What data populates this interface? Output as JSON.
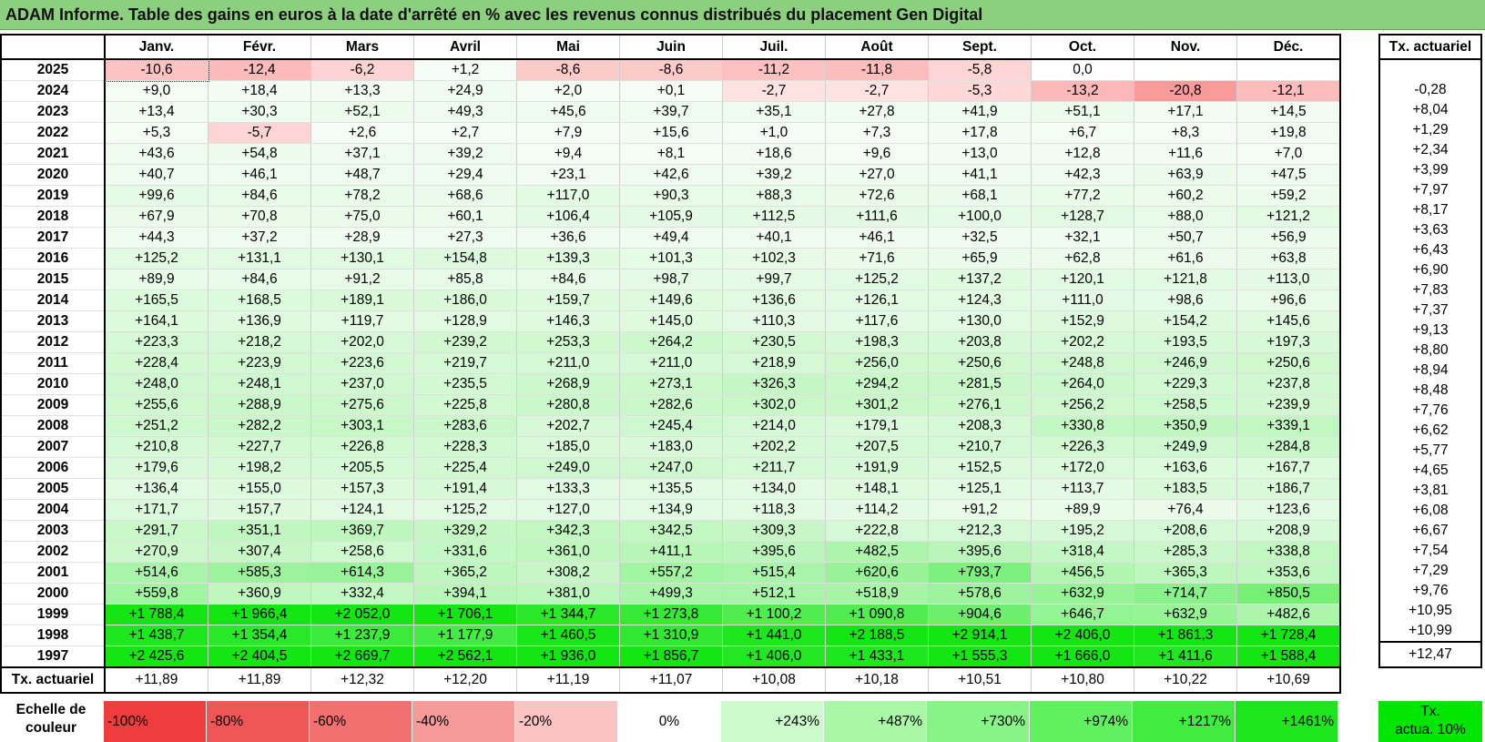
{
  "title": "ADAM Informe. Table des gains en euros à la date d'arrêté en % avec les revenus connus distribués du placement Gen Digital",
  "months": [
    "Janv.",
    "Févr.",
    "Mars",
    "Avril",
    "Mai",
    "Juin",
    "Juil.",
    "Août",
    "Sept.",
    "Oct.",
    "Nov.",
    "Déc."
  ],
  "actuarial_header": "Tx. actuariel",
  "rows": [
    {
      "year": "2025",
      "values": [
        "-10,6",
        "-12,4",
        "-6,2",
        "+1,2",
        "-8,6",
        "-8,6",
        "-11,2",
        "-11,8",
        "-5,8",
        "0,0",
        "",
        ""
      ],
      "rate": ""
    },
    {
      "year": "2024",
      "values": [
        "+9,0",
        "+18,4",
        "+13,3",
        "+24,9",
        "+2,0",
        "+0,1",
        "-2,7",
        "-2,7",
        "-5,3",
        "-13,2",
        "-20,8",
        "-12,1"
      ],
      "rate": "-0,28"
    },
    {
      "year": "2023",
      "values": [
        "+13,4",
        "+30,3",
        "+52,1",
        "+49,3",
        "+45,6",
        "+39,7",
        "+35,1",
        "+27,8",
        "+41,9",
        "+51,1",
        "+17,1",
        "+14,5"
      ],
      "rate": "+8,04"
    },
    {
      "year": "2022",
      "values": [
        "+5,3",
        "-5,7",
        "+2,6",
        "+2,7",
        "+7,9",
        "+15,6",
        "+1,0",
        "+7,3",
        "+17,8",
        "+6,7",
        "+8,3",
        "+19,8"
      ],
      "rate": "+1,29"
    },
    {
      "year": "2021",
      "values": [
        "+43,6",
        "+54,8",
        "+37,1",
        "+39,2",
        "+9,4",
        "+8,1",
        "+18,6",
        "+9,6",
        "+13,0",
        "+12,8",
        "+11,6",
        "+7,0"
      ],
      "rate": "+2,34"
    },
    {
      "year": "2020",
      "values": [
        "+40,7",
        "+46,1",
        "+48,7",
        "+29,4",
        "+23,1",
        "+42,6",
        "+39,2",
        "+27,0",
        "+41,1",
        "+42,3",
        "+63,9",
        "+47,5"
      ],
      "rate": "+3,99"
    },
    {
      "year": "2019",
      "values": [
        "+99,6",
        "+84,6",
        "+78,2",
        "+68,6",
        "+117,0",
        "+90,3",
        "+88,3",
        "+72,6",
        "+68,1",
        "+77,2",
        "+60,2",
        "+59,2"
      ],
      "rate": "+7,97"
    },
    {
      "year": "2018",
      "values": [
        "+67,9",
        "+70,8",
        "+75,0",
        "+60,1",
        "+106,4",
        "+105,9",
        "+112,5",
        "+111,6",
        "+100,0",
        "+128,7",
        "+88,0",
        "+121,2"
      ],
      "rate": "+8,17"
    },
    {
      "year": "2017",
      "values": [
        "+44,3",
        "+37,2",
        "+28,9",
        "+27,3",
        "+36,6",
        "+49,4",
        "+40,1",
        "+46,1",
        "+32,5",
        "+32,1",
        "+50,7",
        "+56,9"
      ],
      "rate": "+3,63"
    },
    {
      "year": "2016",
      "values": [
        "+125,2",
        "+131,1",
        "+130,1",
        "+154,8",
        "+139,3",
        "+101,3",
        "+102,3",
        "+71,6",
        "+65,9",
        "+62,8",
        "+61,6",
        "+63,8"
      ],
      "rate": "+6,43"
    },
    {
      "year": "2015",
      "values": [
        "+89,9",
        "+84,6",
        "+91,2",
        "+85,8",
        "+84,6",
        "+98,7",
        "+99,7",
        "+125,2",
        "+137,2",
        "+120,1",
        "+121,8",
        "+113,0"
      ],
      "rate": "+6,90"
    },
    {
      "year": "2014",
      "values": [
        "+165,5",
        "+168,5",
        "+189,1",
        "+186,0",
        "+159,7",
        "+149,6",
        "+136,6",
        "+126,1",
        "+124,3",
        "+111,0",
        "+98,6",
        "+96,6"
      ],
      "rate": "+7,83"
    },
    {
      "year": "2013",
      "values": [
        "+164,1",
        "+136,9",
        "+119,7",
        "+128,9",
        "+146,3",
        "+145,0",
        "+110,3",
        "+117,6",
        "+130,0",
        "+152,9",
        "+154,2",
        "+145,6"
      ],
      "rate": "+7,37"
    },
    {
      "year": "2012",
      "values": [
        "+223,3",
        "+218,2",
        "+202,0",
        "+239,2",
        "+253,3",
        "+264,2",
        "+230,5",
        "+198,3",
        "+203,8",
        "+202,2",
        "+193,5",
        "+197,3"
      ],
      "rate": "+9,13"
    },
    {
      "year": "2011",
      "values": [
        "+228,4",
        "+223,9",
        "+223,6",
        "+219,7",
        "+211,0",
        "+211,0",
        "+218,9",
        "+256,0",
        "+250,6",
        "+248,8",
        "+246,9",
        "+250,6"
      ],
      "rate": "+8,80"
    },
    {
      "year": "2010",
      "values": [
        "+248,0",
        "+248,1",
        "+237,0",
        "+235,5",
        "+268,9",
        "+273,1",
        "+326,3",
        "+294,2",
        "+281,5",
        "+264,0",
        "+229,3",
        "+237,8"
      ],
      "rate": "+8,94"
    },
    {
      "year": "2009",
      "values": [
        "+255,6",
        "+288,9",
        "+275,6",
        "+225,8",
        "+280,8",
        "+282,6",
        "+302,0",
        "+301,2",
        "+276,1",
        "+256,2",
        "+258,5",
        "+239,9"
      ],
      "rate": "+8,48"
    },
    {
      "year": "2008",
      "values": [
        "+251,2",
        "+282,2",
        "+303,1",
        "+283,6",
        "+202,7",
        "+245,4",
        "+214,0",
        "+179,1",
        "+208,3",
        "+330,8",
        "+350,9",
        "+339,1"
      ],
      "rate": "+7,76"
    },
    {
      "year": "2007",
      "values": [
        "+210,8",
        "+227,7",
        "+226,8",
        "+228,3",
        "+185,0",
        "+183,0",
        "+202,2",
        "+207,5",
        "+210,7",
        "+226,3",
        "+249,9",
        "+284,8"
      ],
      "rate": "+6,62"
    },
    {
      "year": "2006",
      "values": [
        "+179,6",
        "+198,2",
        "+205,5",
        "+225,4",
        "+249,0",
        "+247,0",
        "+211,7",
        "+191,9",
        "+152,5",
        "+172,0",
        "+163,6",
        "+167,7"
      ],
      "rate": "+5,77"
    },
    {
      "year": "2005",
      "values": [
        "+136,4",
        "+155,0",
        "+157,3",
        "+191,4",
        "+133,3",
        "+135,5",
        "+134,0",
        "+148,1",
        "+125,1",
        "+113,7",
        "+183,5",
        "+186,7"
      ],
      "rate": "+4,65"
    },
    {
      "year": "2004",
      "values": [
        "+171,7",
        "+157,7",
        "+124,1",
        "+125,2",
        "+127,0",
        "+134,9",
        "+118,3",
        "+114,2",
        "+91,2",
        "+89,9",
        "+76,4",
        "+123,6"
      ],
      "rate": "+3,81"
    },
    {
      "year": "2003",
      "values": [
        "+291,7",
        "+351,1",
        "+369,7",
        "+329,2",
        "+342,3",
        "+342,5",
        "+309,3",
        "+222,8",
        "+212,3",
        "+195,2",
        "+208,6",
        "+208,9"
      ],
      "rate": "+6,08"
    },
    {
      "year": "2002",
      "values": [
        "+270,9",
        "+307,4",
        "+258,6",
        "+331,6",
        "+361,0",
        "+411,1",
        "+395,6",
        "+482,5",
        "+395,6",
        "+318,4",
        "+285,3",
        "+338,8"
      ],
      "rate": "+6,67"
    },
    {
      "year": "2001",
      "values": [
        "+514,6",
        "+585,3",
        "+614,3",
        "+365,2",
        "+308,2",
        "+557,2",
        "+515,4",
        "+620,6",
        "+793,7",
        "+456,5",
        "+365,3",
        "+353,6"
      ],
      "rate": "+7,54"
    },
    {
      "year": "2000",
      "values": [
        "+559,8",
        "+360,9",
        "+332,4",
        "+394,1",
        "+381,0",
        "+499,3",
        "+512,1",
        "+518,9",
        "+578,6",
        "+632,9",
        "+714,7",
        "+850,5"
      ],
      "rate": "+7,29"
    },
    {
      "year": "1999",
      "values": [
        "+1 788,4",
        "+1 966,4",
        "+2 052,0",
        "+1 706,1",
        "+1 344,7",
        "+1 273,8",
        "+1 100,2",
        "+1 090,8",
        "+904,6",
        "+646,7",
        "+632,9",
        "+482,6"
      ],
      "rate": "+9,76"
    },
    {
      "year": "1998",
      "values": [
        "+1 438,7",
        "+1 354,4",
        "+1 237,9",
        "+1 177,9",
        "+1 460,5",
        "+1 310,9",
        "+1 441,0",
        "+2 188,5",
        "+2 914,1",
        "+2 406,0",
        "+1 861,3",
        "+1 728,4"
      ],
      "rate": "+10,95"
    },
    {
      "year": "1997",
      "values": [
        "+2 425,6",
        "+2 404,5",
        "+2 669,7",
        "+2 562,1",
        "+1 936,0",
        "+1 856,7",
        "+1 406,0",
        "+1 433,1",
        "+1 555,3",
        "+1 666,0",
        "+1 411,6",
        "+1 588,4"
      ],
      "rate": "+10,99"
    }
  ],
  "tx_row": {
    "label": "Tx. actuariel",
    "values": [
      "+11,89",
      "+11,89",
      "+12,32",
      "+12,20",
      "+11,19",
      "+11,07",
      "+10,08",
      "+10,18",
      "+10,51",
      "+10,80",
      "+10,22",
      "+10,69"
    ],
    "overall": "+12,47"
  },
  "legend": {
    "label_line1": "Echelle de",
    "label_line2": "couleur",
    "items": [
      {
        "text": "-100%",
        "color": "#ef3d3d",
        "align": "left"
      },
      {
        "text": "-80%",
        "color": "#f15656",
        "align": "left"
      },
      {
        "text": "-60%",
        "color": "#f37070",
        "align": "left"
      },
      {
        "text": "-40%",
        "color": "#f69a9a",
        "align": "left"
      },
      {
        "text": "-20%",
        "color": "#fbc4c4",
        "align": "left"
      },
      {
        "text": "0%",
        "color": "#ffffff",
        "align": "center"
      },
      {
        "text": "+243%",
        "color": "#ccfccc",
        "align": "right"
      },
      {
        "text": "+487%",
        "color": "#a8f8a8",
        "align": "right"
      },
      {
        "text": "+730%",
        "color": "#88f488",
        "align": "right"
      },
      {
        "text": "+974%",
        "color": "#60f060",
        "align": "right"
      },
      {
        "text": "+1217%",
        "color": "#40ec40",
        "align": "right"
      },
      {
        "text": "+1461%",
        "color": "#1ee61e",
        "align": "right"
      }
    ],
    "actuarial_line1": "Tx.",
    "actuarial_line2": "actua. 10%",
    "actuarial_color": "#00e600"
  }
}
